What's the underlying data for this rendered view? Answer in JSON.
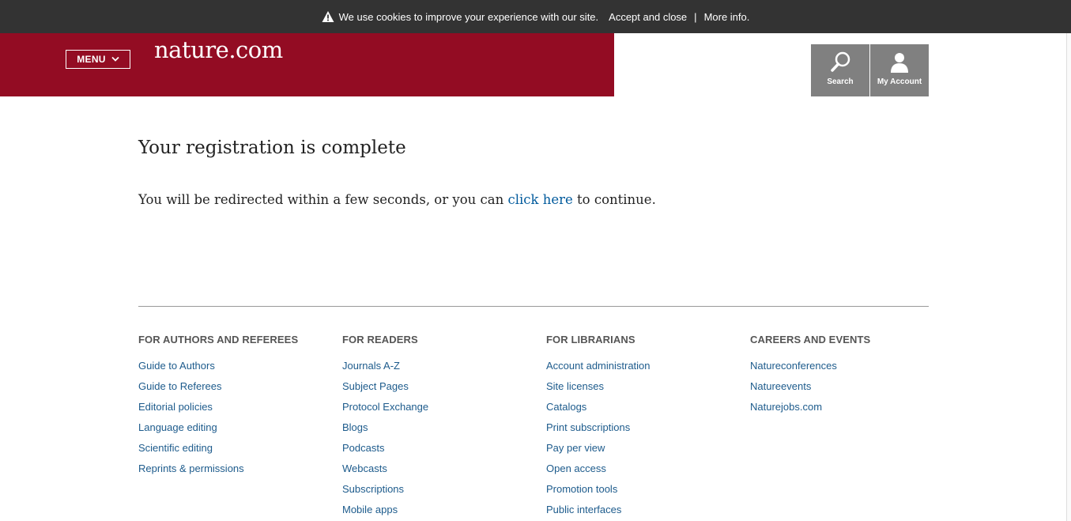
{
  "cookie_bar": {
    "icon": "warning-icon",
    "text": "We use cookies to improve your experience with our site.",
    "accept_label": "Accept and close",
    "separator": "|",
    "more_label": "More info."
  },
  "header": {
    "menu_label": "MENU",
    "logo_text": "nature.com",
    "search_label": "Search",
    "account_label": "My Account",
    "brand_color": "#930c23"
  },
  "main": {
    "title": "Your registration is complete",
    "message_before": "You will be redirected within a few seconds, or you can ",
    "link_label": "click here",
    "message_after": " to continue."
  },
  "footer": {
    "columns": [
      {
        "heading": "FOR AUTHORS AND REFEREES",
        "links": [
          "Guide to Authors",
          "Guide to Referees",
          "Editorial policies",
          "Language editing",
          "Scientific editing",
          "Reprints & permissions"
        ]
      },
      {
        "heading": "FOR READERS",
        "links": [
          "Journals A-Z",
          "Subject Pages",
          "Protocol Exchange",
          "Blogs",
          "Podcasts",
          "Webcasts",
          "Subscriptions",
          "Mobile apps"
        ]
      },
      {
        "heading": "FOR LIBRARIANS",
        "links": [
          "Account administration",
          "Site licenses",
          "Catalogs",
          "Print subscriptions",
          "Pay per view",
          "Open access",
          "Promotion tools",
          "Public interfaces"
        ]
      },
      {
        "heading": "CAREERS AND EVENTS",
        "links": [
          "Natureconferences",
          "Natureevents",
          "Naturejobs.com"
        ]
      }
    ]
  }
}
